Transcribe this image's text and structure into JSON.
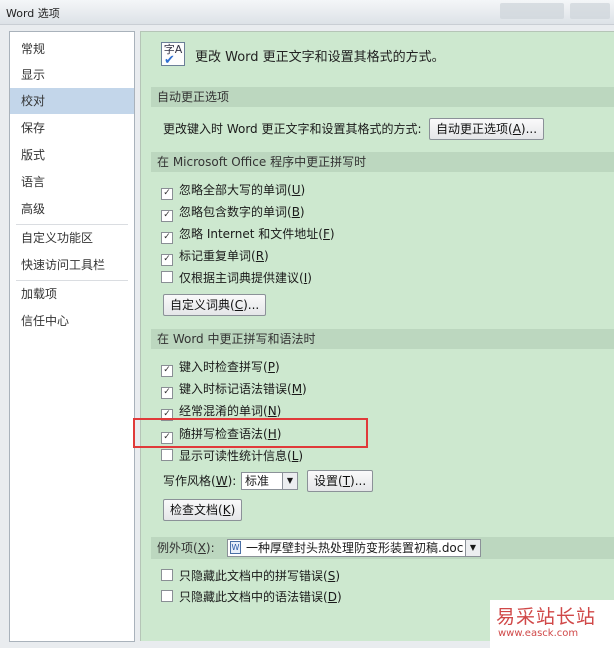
{
  "window": {
    "title": "Word 选项"
  },
  "sidebar": {
    "items": [
      {
        "label": "常规"
      },
      {
        "label": "显示"
      },
      {
        "label": "校对"
      },
      {
        "label": "保存"
      },
      {
        "label": "版式"
      },
      {
        "label": "语言"
      },
      {
        "label": "高级"
      },
      {
        "label": "自定义功能区"
      },
      {
        "label": "快速访问工具栏"
      },
      {
        "label": "加载项"
      },
      {
        "label": "信任中心"
      }
    ],
    "selected": "校对"
  },
  "header": {
    "icon_text": "字A",
    "text": "更改 Word 更正文字和设置其格式的方式。"
  },
  "autocorrect": {
    "section_title": "自动更正选项",
    "label": "更改键入时 Word 更正文字和设置其格式的方式:",
    "button_pre": "自动更正选项(",
    "button_key": "A",
    "button_post": ")..."
  },
  "office_spelling": {
    "section_title": "在 Microsoft Office 程序中更正拼写时",
    "options": [
      {
        "pre": "忽略全部大写的单词(",
        "key": "U",
        "post": ")",
        "checked": true
      },
      {
        "pre": "忽略包含数字的单词(",
        "key": "B",
        "post": ")",
        "checked": true
      },
      {
        "pre": "忽略 Internet 和文件地址(",
        "key": "F",
        "post": ")",
        "checked": true
      },
      {
        "pre": "标记重复单词(",
        "key": "R",
        "post": ")",
        "checked": true
      },
      {
        "pre": "仅根据主词典提供建议(",
        "key": "I",
        "post": ")",
        "checked": false
      }
    ],
    "dict_button_pre": "自定义词典(",
    "dict_button_key": "C",
    "dict_button_post": ")..."
  },
  "word_grammar": {
    "section_title": "在 Word 中更正拼写和语法时",
    "options": [
      {
        "pre": "键入时检查拼写(",
        "key": "P",
        "post": ")",
        "checked": true
      },
      {
        "pre": "键入时标记语法错误(",
        "key": "M",
        "post": ")",
        "checked": true
      },
      {
        "pre": "经常混淆的单词(",
        "key": "N",
        "post": ")",
        "checked": true
      },
      {
        "pre": "随拼写检查语法(",
        "key": "H",
        "post": ")",
        "checked": true
      },
      {
        "pre": "显示可读性统计信息(",
        "key": "L",
        "post": ")",
        "checked": false
      }
    ],
    "style_label_pre": "写作风格(",
    "style_label_key": "W",
    "style_label_post": "):",
    "style_value": "标准",
    "settings_button_pre": "设置(",
    "settings_button_key": "T",
    "settings_button_post": ")...",
    "check_doc_button_pre": "检查文档(",
    "check_doc_button_key": "K",
    "check_doc_button_post": ")"
  },
  "exceptions": {
    "label_pre": "例外项(",
    "label_key": "X",
    "label_post": "):",
    "document": "一种厚壁封头热处理防变形装置初稿.doc",
    "options": [
      {
        "pre": "只隐藏此文档中的拼写错误(",
        "key": "S",
        "post": ")",
        "checked": false
      },
      {
        "pre": "只隐藏此文档中的语法错误(",
        "key": "D",
        "post": ")",
        "checked": false
      }
    ]
  },
  "watermark": {
    "line1": "易采站长站",
    "line2": "www.easck.com"
  },
  "colors": {
    "panel_bg": "#cde8cf",
    "section_bg": "#bcd7bf",
    "selected_nav": "#c3d6ea",
    "highlight": "#e03a3a"
  }
}
